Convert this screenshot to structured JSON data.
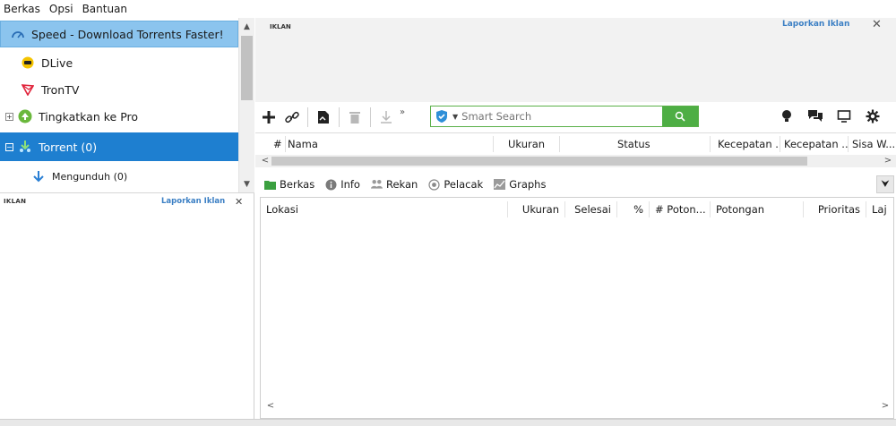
{
  "menu": {
    "items": [
      "Berkas",
      "Opsi",
      "Bantuan"
    ]
  },
  "sidebar": {
    "items": [
      {
        "label": "Speed - Download Torrents Faster!",
        "icon": "speed-icon"
      },
      {
        "label": "DLive",
        "icon": "dlive-icon"
      },
      {
        "label": "TronTV",
        "icon": "trontv-icon"
      },
      {
        "label": "Tingkatkan ke Pro",
        "icon": "pro-icon"
      },
      {
        "label": "Torrent (0)",
        "icon": "torrent-icon"
      },
      {
        "label": "Mengunduh (0)",
        "icon": "download-arrow-icon"
      }
    ]
  },
  "ad_left": {
    "label": "IKLAN",
    "report": "Laporkan Iklan"
  },
  "ad_top": {
    "label": "IKLAN",
    "report": "Laporkan Iklan"
  },
  "search": {
    "placeholder": "Smart Search"
  },
  "torrent_list": {
    "columns": [
      "#",
      "Nama",
      "Ukuran",
      "Status",
      "Kecepatan ...",
      "Kecepatan ...",
      "Sisa W..."
    ]
  },
  "tabs": [
    {
      "label": "Berkas",
      "icon": "files-icon"
    },
    {
      "label": "Info",
      "icon": "info-icon"
    },
    {
      "label": "Rekan",
      "icon": "peers-icon"
    },
    {
      "label": "Pelacak",
      "icon": "tracker-icon"
    },
    {
      "label": "Graphs",
      "icon": "graphs-icon"
    }
  ],
  "files_table": {
    "columns": [
      "Lokasi",
      "Ukuran",
      "Selesai",
      "%",
      "# Poton...",
      "Potongan",
      "Prioritas",
      "Laj"
    ]
  },
  "colors": {
    "selected": "#1e7fd0",
    "highlight": "#8bc4ee",
    "search_green": "#4eae44",
    "link_blue": "#3b7fc4"
  }
}
